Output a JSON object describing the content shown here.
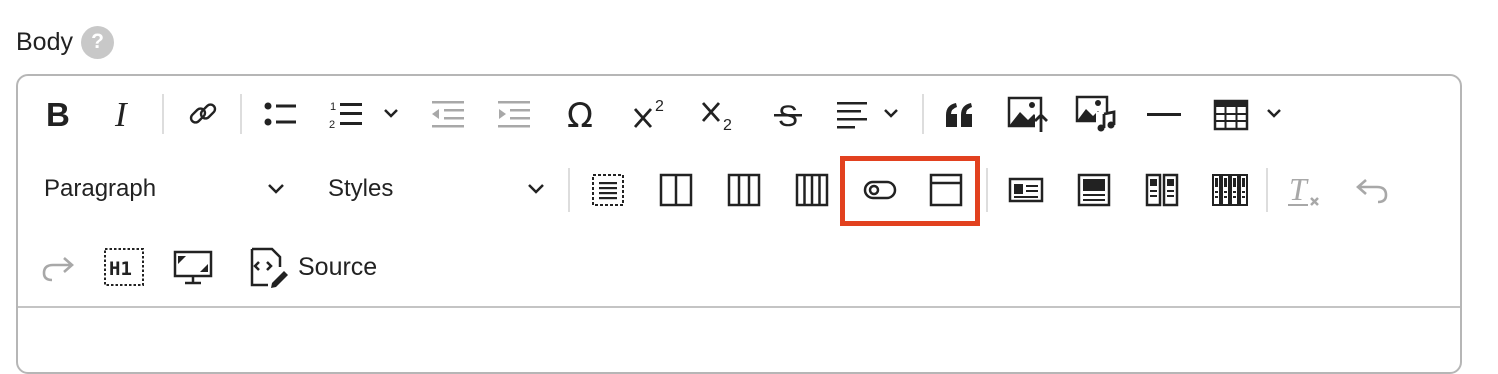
{
  "field": {
    "label": "Body",
    "help_glyph": "?"
  },
  "toolbar": {
    "paragraph_select": {
      "value": "Paragraph"
    },
    "styles_select": {
      "value": "Styles"
    },
    "source": {
      "label": "Source"
    },
    "highlight_color": "#e2411f",
    "icon_color": "#222222",
    "disabled_icon_color": "#a8a8a8",
    "icons": [
      "bold-icon",
      "italic-icon",
      "link-icon",
      "bulleted-list-icon",
      "numbered-list-icon",
      "outdent-icon",
      "indent-icon",
      "special-characters-icon",
      "superscript-icon",
      "subscript-icon",
      "strikethrough-icon",
      "alignment-icon",
      "blockquote-icon",
      "insert-image-icon",
      "insert-media-icon",
      "horizontal-line-icon",
      "table-icon",
      "text-box-icon",
      "two-columns-icon",
      "three-columns-icon",
      "four-columns-icon",
      "toggle-icon",
      "window-icon",
      "media-card-icon",
      "hero-card-icon",
      "two-cards-icon",
      "four-cards-icon",
      "remove-format-icon",
      "undo-icon",
      "redo-icon",
      "heading-h1-icon",
      "presentation-icon",
      "source-icon"
    ]
  }
}
